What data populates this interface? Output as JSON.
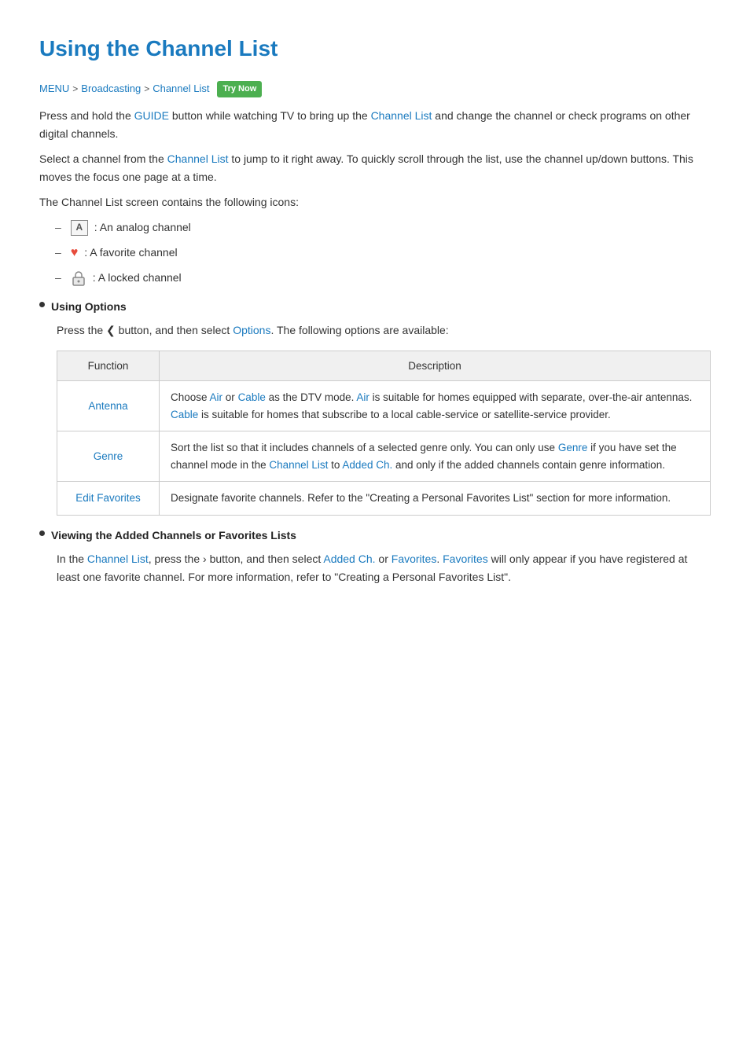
{
  "title": "Using the Channel List",
  "breadcrumb": {
    "items": [
      "MENU",
      "Broadcasting",
      "Channel List"
    ],
    "separators": [
      ">",
      ">"
    ],
    "try_now": "Try Now"
  },
  "paragraphs": {
    "p1": "Press and hold the GUIDE button while watching TV to bring up the Channel List and change the channel or check programs on other digital channels.",
    "p1_links": [
      "GUIDE",
      "Channel List"
    ],
    "p2": "Select a channel from the Channel List to jump to it right away. To quickly scroll through the list, use the channel up/down buttons. This moves the focus one page at a time.",
    "p2_links": [
      "Channel List"
    ],
    "p3": "The Channel List screen contains the following icons:"
  },
  "icons_list": [
    {
      "icon_type": "A",
      "label": ": An analog channel"
    },
    {
      "icon_type": "heart",
      "label": ": A favorite channel"
    },
    {
      "icon_type": "lock",
      "label": ": A locked channel"
    }
  ],
  "section_using_options": {
    "header": "Using Options",
    "description_prefix": "Press the ",
    "chevron": "❮",
    "description_mid": " button, and then select ",
    "options_link": "Options",
    "description_suffix": ". The following options are available:"
  },
  "table": {
    "headers": [
      "Function",
      "Description"
    ],
    "rows": [
      {
        "function": "Antenna",
        "description": "Choose Air or Cable as the DTV mode. Air is suitable for homes equipped with separate, over-the-air antennas. Cable is suitable for homes that subscribe to a local cable-service or satellite-service provider.",
        "links": [
          "Air",
          "Cable",
          "Air",
          "Cable"
        ]
      },
      {
        "function": "Genre",
        "description": "Sort the list so that it includes channels of a selected genre only. You can only use Genre if you have set the channel mode in the Channel List to Added Ch. and only if the added channels contain genre information.",
        "links": [
          "Genre",
          "Channel List",
          "Added Ch."
        ]
      },
      {
        "function": "Edit Favorites",
        "description": "Designate favorite channels. Refer to the \"Creating a Personal Favorites List\" section for more information.",
        "links": []
      }
    ]
  },
  "section_viewing": {
    "header": "Viewing the Added Channels or Favorites Lists",
    "description": "In the Channel List, press the › button, and then select Added Ch. or Favorites. Favorites will only appear if you have registered at least one favorite channel. For more information, refer to \"Creating a Personal Favorites List\".",
    "links": [
      "Channel List",
      "Added Ch.",
      "Favorites",
      "Favorites"
    ]
  }
}
